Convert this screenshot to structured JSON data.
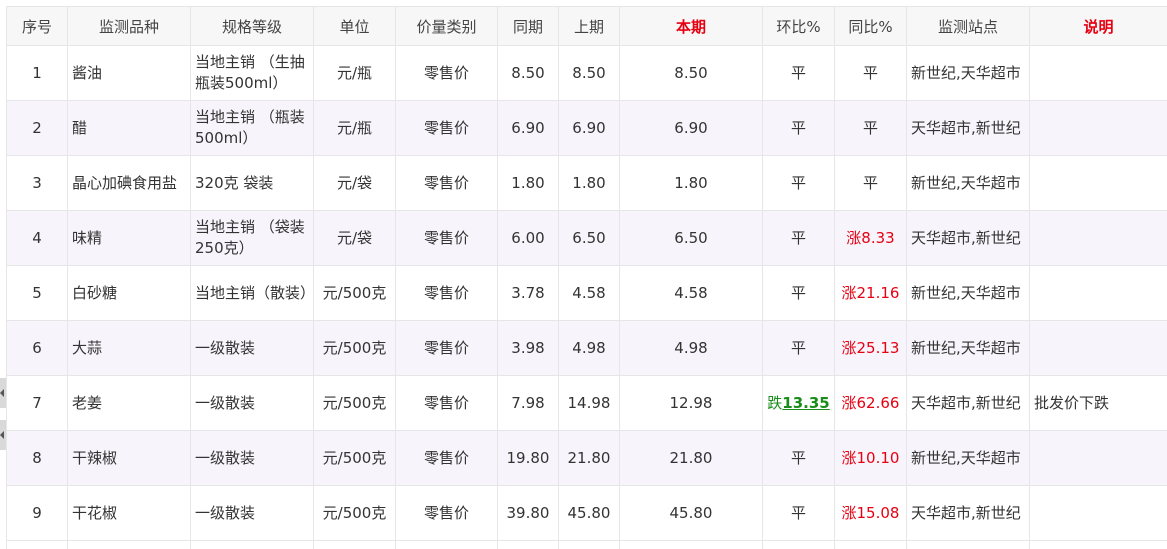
{
  "headers": [
    "序号",
    "监测品种",
    "规格等级",
    "单位",
    "价量类别",
    "同期",
    "上期",
    "本期",
    "环比%",
    "同比%",
    "监测站点",
    "说明"
  ],
  "rows": [
    {
      "no": "1",
      "name": "酱油",
      "spec": "当地主销 （生抽瓶装500ml）",
      "unit": "元/瓶",
      "kind": "零售价",
      "same": "8.50",
      "prev": "8.50",
      "cur": "8.50",
      "hb_prefix": "",
      "hb": "平",
      "tb": "平",
      "site": "新世纪,天华超市",
      "note": ""
    },
    {
      "no": "2",
      "name": "醋",
      "spec": "当地主销 （瓶装500ml）",
      "unit": "元/瓶",
      "kind": "零售价",
      "same": "6.90",
      "prev": "6.90",
      "cur": "6.90",
      "hb_prefix": "",
      "hb": "平",
      "tb": "平",
      "site": "天华超市,新世纪",
      "note": ""
    },
    {
      "no": "3",
      "name": "晶心加碘食用盐",
      "spec": "320克 袋装",
      "unit": "元/袋",
      "kind": "零售价",
      "same": "1.80",
      "prev": "1.80",
      "cur": "1.80",
      "hb_prefix": "",
      "hb": "平",
      "tb": "平",
      "site": "新世纪,天华超市",
      "note": ""
    },
    {
      "no": "4",
      "name": "味精",
      "spec": "当地主销 （袋装250克）",
      "unit": "元/袋",
      "kind": "零售价",
      "same": "6.00",
      "prev": "6.50",
      "cur": "6.50",
      "hb_prefix": "",
      "hb": "平",
      "tb": "涨8.33",
      "site": "天华超市,新世纪",
      "note": ""
    },
    {
      "no": "5",
      "name": "白砂糖",
      "spec": "当地主销（散装）",
      "unit": "元/500克",
      "kind": "零售价",
      "same": "3.78",
      "prev": "4.58",
      "cur": "4.58",
      "hb_prefix": "",
      "hb": "平",
      "tb": "涨21.16",
      "site": "新世纪,天华超市",
      "note": ""
    },
    {
      "no": "6",
      "name": "大蒜",
      "spec": "一级散装",
      "unit": "元/500克",
      "kind": "零售价",
      "same": "3.98",
      "prev": "4.98",
      "cur": "4.98",
      "hb_prefix": "",
      "hb": "平",
      "tb": "涨25.13",
      "site": "新世纪,天华超市",
      "note": ""
    },
    {
      "no": "7",
      "name": "老姜",
      "spec": "一级散装",
      "unit": "元/500克",
      "kind": "零售价",
      "same": "7.98",
      "prev": "14.98",
      "cur": "12.98",
      "hb_prefix": "跌",
      "hb": "13.35",
      "tb": "涨62.66",
      "site": "天华超市,新世纪",
      "note": "批发价下跌"
    },
    {
      "no": "8",
      "name": "干辣椒",
      "spec": "一级散装",
      "unit": "元/500克",
      "kind": "零售价",
      "same": "19.80",
      "prev": "21.80",
      "cur": "21.80",
      "hb_prefix": "",
      "hb": "平",
      "tb": "涨10.10",
      "site": "新世纪,天华超市",
      "note": ""
    },
    {
      "no": "9",
      "name": "干花椒",
      "spec": "一级散装",
      "unit": "元/500克",
      "kind": "零售价",
      "same": "39.80",
      "prev": "45.80",
      "cur": "45.80",
      "hb_prefix": "",
      "hb": "平",
      "tb": "涨15.08",
      "site": "天华超市,新世纪",
      "note": ""
    }
  ],
  "colors": {
    "rise": "#e60012",
    "fall": "#1a8c1a",
    "header_bg": "#f7f7f7",
    "alt_row": "#f7f5fb",
    "border": "#e6e6e6"
  },
  "icons": {
    "side_tab": "chevron-left-icon"
  }
}
